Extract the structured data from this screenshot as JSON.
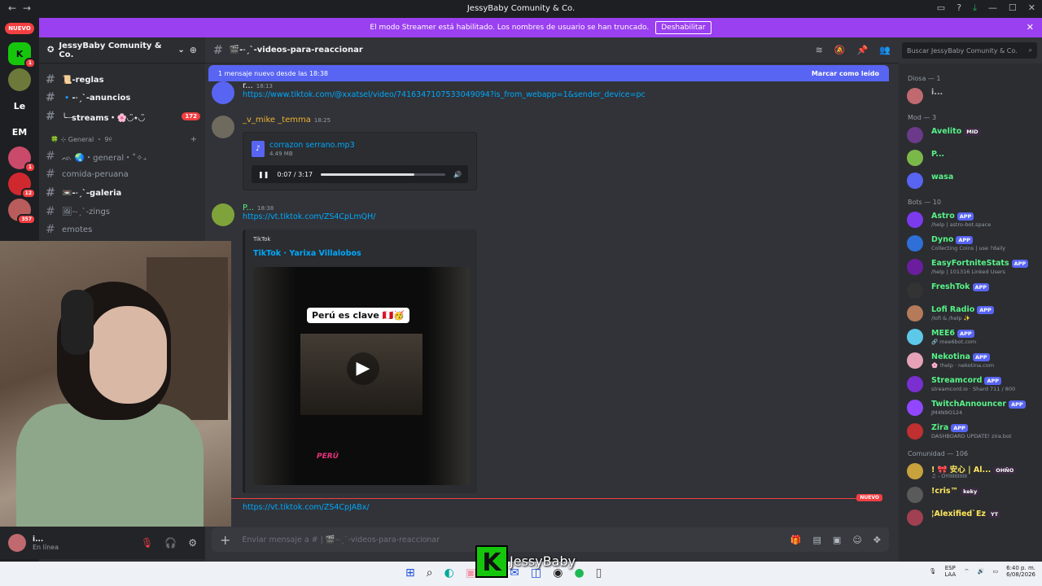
{
  "window": {
    "title": "JessyBaby Comunity & Co."
  },
  "streamer_banner": {
    "text": "El modo Streamer está habilitado. Los nombres de usuario se han truncado.",
    "disable_label": "Deshabilitar"
  },
  "server_rail": {
    "nuevo_label": "NUEVO",
    "servers": [
      {
        "label": "K",
        "badge": "1"
      },
      {
        "label": "",
        "badge": ""
      },
      {
        "label": "Le",
        "badge": ""
      },
      {
        "label": "EM",
        "badge": ""
      },
      {
        "label": "",
        "badge": "1"
      },
      {
        "label": "",
        "badge": "12"
      },
      {
        "label": "",
        "badge": "357"
      }
    ]
  },
  "server": {
    "name": "JessyBaby Comunity & Co."
  },
  "channels": [
    {
      "name": "📜-reglas",
      "bold": true
    },
    {
      "name": "🔹-˗ˏˋ-anuncios",
      "bold": true
    },
    {
      "name": "╰┈streams・🌸◡̈⋆◡̈",
      "bold": true,
      "count": "172"
    },
    {
      "name": "ᨒ 🌏・general・˚✧₊",
      "bold": false
    },
    {
      "name": "comida-peruana",
      "bold": false
    },
    {
      "name": "📼-˗ˏˋ-galeria",
      "bold": true
    },
    {
      "name": "🖼-˗ˏˋ-zings",
      "bold": false
    },
    {
      "name": "emotes",
      "bold": false
    }
  ],
  "category": {
    "label": "🍀 ⊹ General ・ 9୧"
  },
  "user_panel": {
    "name": "i...",
    "status": "En línea"
  },
  "chat": {
    "channel": "🎬-˗ˏˋ-videos-para-reaccionar",
    "search_placeholder": "Buscar JessyBaby Comunity & Co.",
    "new_bar": "1 mensaje nuevo desde las 18:38",
    "mark_read": "Marcar como leído",
    "messages": [
      {
        "author": "r...",
        "time": "18:13",
        "text": "https://www.tiktok.com/@xxatsel/video/7416347107533049094?is_from_webapp=1&sender_device=pc"
      },
      {
        "author": "_v_mike _temma",
        "time": "18:25",
        "text": ""
      },
      {
        "author": "P...",
        "time": "18:38",
        "text": "https://vt.tiktok.com/ZS4CpLmQH/"
      }
    ],
    "audio": {
      "filename": "corrazon serrano.mp3",
      "size": "4.49 MB",
      "time": "0:07 / 3:17",
      "progress": 0.75
    },
    "embed": {
      "provider": "TikTok",
      "title": "TikTok · Yarixa Villalobos",
      "caption": "Perú es clave 🇵🇪🥳",
      "footer": "PERÚ"
    },
    "divider_label": "NUEVO",
    "tail_link": "https://vt.tiktok.com/ZS4CpJABx/",
    "composer_placeholder": "Enviar mensaje a # | 🎬-˗ˏˋ-videos-para-reaccionar"
  },
  "members": {
    "groups": [
      {
        "header": "Diosa — 1",
        "items": [
          {
            "name": "i...",
            "sub": "",
            "tag": "",
            "color": "#b5bac1"
          }
        ]
      },
      {
        "header": "Mod — 3",
        "items": [
          {
            "name": "Avelito",
            "sub": "",
            "tag": "MID",
            "color": "#57f287"
          },
          {
            "name": "P...",
            "sub": "",
            "tag": "",
            "color": "#57f287"
          },
          {
            "name": "wasa",
            "sub": "",
            "tag": "",
            "color": "#57f287"
          }
        ]
      },
      {
        "header": "Bots — 10",
        "items": [
          {
            "name": "Astro",
            "sub": "/help | astro-bot.space",
            "tag": "APP",
            "color": "#57f287"
          },
          {
            "name": "Dyno",
            "sub": "Collecting Coins | use ?daily",
            "tag": "APP",
            "color": "#57f287"
          },
          {
            "name": "EasyFortniteStats",
            "sub": "/help | 101316 Linked Users",
            "tag": "APP",
            "color": "#57f287"
          },
          {
            "name": "FreshTok",
            "sub": "",
            "tag": "APP",
            "color": "#57f287"
          },
          {
            "name": "Lofi Radio",
            "sub": "/lofi & /help ✨",
            "tag": "APP",
            "color": "#57f287"
          },
          {
            "name": "MEE6",
            "sub": "🔗 mee6bot.com",
            "tag": "APP",
            "color": "#57f287"
          },
          {
            "name": "Nekotina",
            "sub": "🌸 !help · nekotina.com",
            "tag": "APP",
            "color": "#57f287"
          },
          {
            "name": "Streamcord",
            "sub": "streamcord.io · Shard 711 / 800",
            "tag": "APP",
            "color": "#57f287"
          },
          {
            "name": "TwitchAnnouncer",
            "sub": "JM4N9O124",
            "tag": "APP",
            "color": "#57f287"
          },
          {
            "name": "Zira",
            "sub": "DASHBOARD UPDATE! zira.bot",
            "tag": "APP",
            "color": "#57f287"
          }
        ]
      },
      {
        "header": "Comunidad — 106",
        "items": [
          {
            "name": "! 🎀 安心 | Al...",
            "sub": "♫ - OYIIIIIIIIIIII",
            "tag": "OHÑO",
            "color": "#fee75c"
          },
          {
            "name": "!cris™",
            "sub": "",
            "tag": "keky",
            "color": "#fee75c"
          },
          {
            "name": "¦Alexified`Ez",
            "sub": "",
            "tag": "YT",
            "color": "#fee75c"
          }
        ]
      }
    ]
  },
  "taskbar": {
    "lang": "ESP",
    "lang2": "LAA",
    "time": "6:40 p. m.",
    "date": "6/08/2026"
  },
  "overlay": {
    "logo": "K",
    "name": "JessyBaby"
  }
}
